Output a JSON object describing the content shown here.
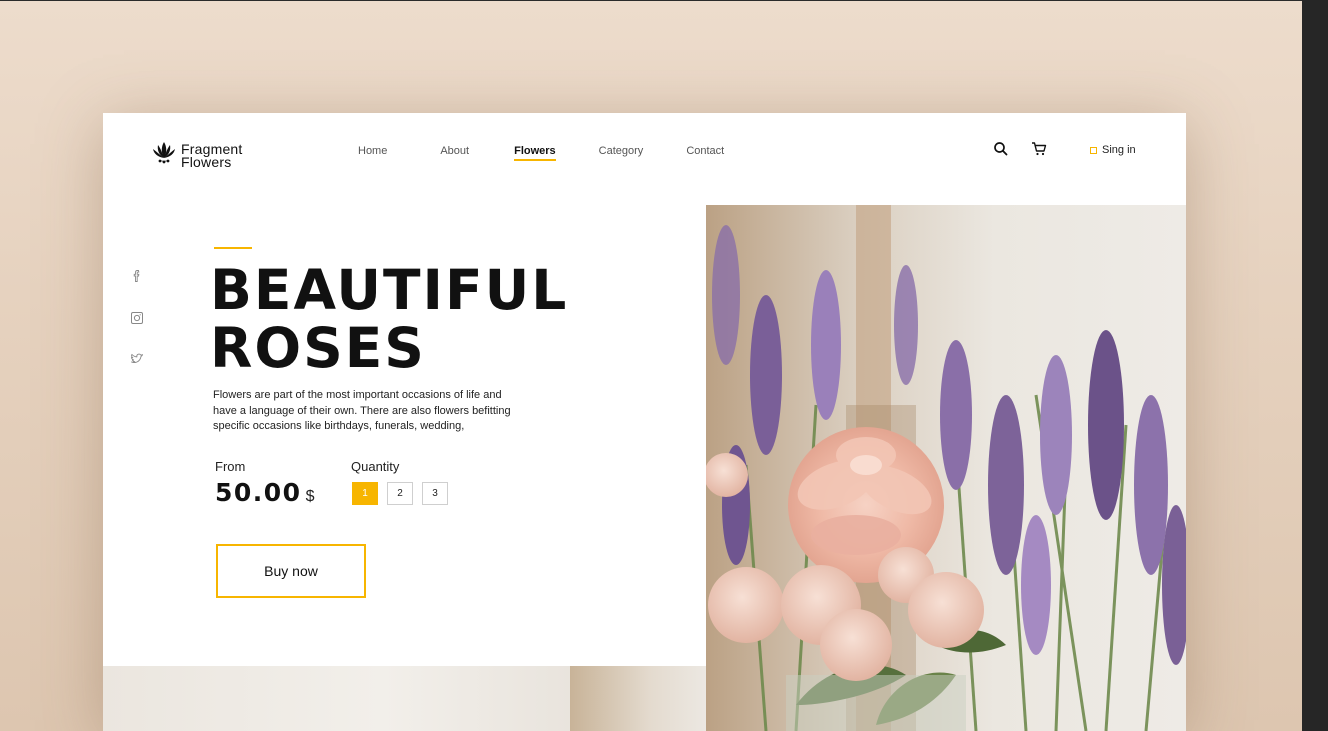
{
  "brand": {
    "line1": "Fragment",
    "line2": "Flowers",
    "logo_icon": "lotus-icon"
  },
  "nav": {
    "items": [
      {
        "label": "Home",
        "active": false
      },
      {
        "label": "About",
        "active": false
      },
      {
        "label": "Flowers",
        "active": true
      },
      {
        "label": "Category",
        "active": false
      },
      {
        "label": "Contact",
        "active": false
      }
    ]
  },
  "header": {
    "search_icon": "search-icon",
    "cart_icon": "cart-icon",
    "signin_label": "Sing in"
  },
  "social": [
    "facebook-icon",
    "instagram-icon",
    "twitter-icon"
  ],
  "hero": {
    "title_line1": "BEAUTIFUL",
    "title_line2": "ROSES",
    "description": "Flowers are part of the most important occasions of life and have a language of their own. There are also flowers befitting specific occasions like birthdays, funerals, wedding,"
  },
  "pricing": {
    "from_label": "From",
    "price": "50.00",
    "currency": "$"
  },
  "quantity": {
    "label": "Quantity",
    "options": [
      "1",
      "2",
      "3"
    ],
    "selected": "1"
  },
  "buy_button": {
    "label": "Buy now"
  },
  "colors": {
    "accent": "#f7b500",
    "background": "#eddccc",
    "text": "#111111"
  }
}
